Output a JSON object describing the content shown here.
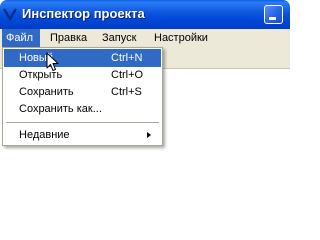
{
  "window": {
    "title": "Инспектор проекта",
    "icon": "app-icon",
    "minimize_icon": "minimize-icon"
  },
  "menubar": {
    "items": [
      {
        "label": "Файл",
        "active": true
      },
      {
        "label": "Правка",
        "active": false
      },
      {
        "label": "Запуск",
        "active": false
      },
      {
        "label": "Настройки",
        "active": false
      }
    ]
  },
  "file_menu": {
    "items": [
      {
        "label": "Новый",
        "shortcut": "Ctrl+N",
        "highlighted": true
      },
      {
        "label": "Открыть",
        "shortcut": "Ctrl+O",
        "highlighted": false
      },
      {
        "label": "Сохранить",
        "shortcut": "Ctrl+S",
        "highlighted": false
      },
      {
        "label": "Сохранить как...",
        "shortcut": "",
        "highlighted": false
      },
      {
        "label": "Недавние",
        "shortcut": "",
        "highlighted": false,
        "submenu": true
      }
    ]
  },
  "colors": {
    "title_bar": "#0054e3",
    "menu_highlight": "#316ac5",
    "menu_bar_bg": "#ece9d8"
  },
  "cursor_icon": "mouse-pointer-icon"
}
